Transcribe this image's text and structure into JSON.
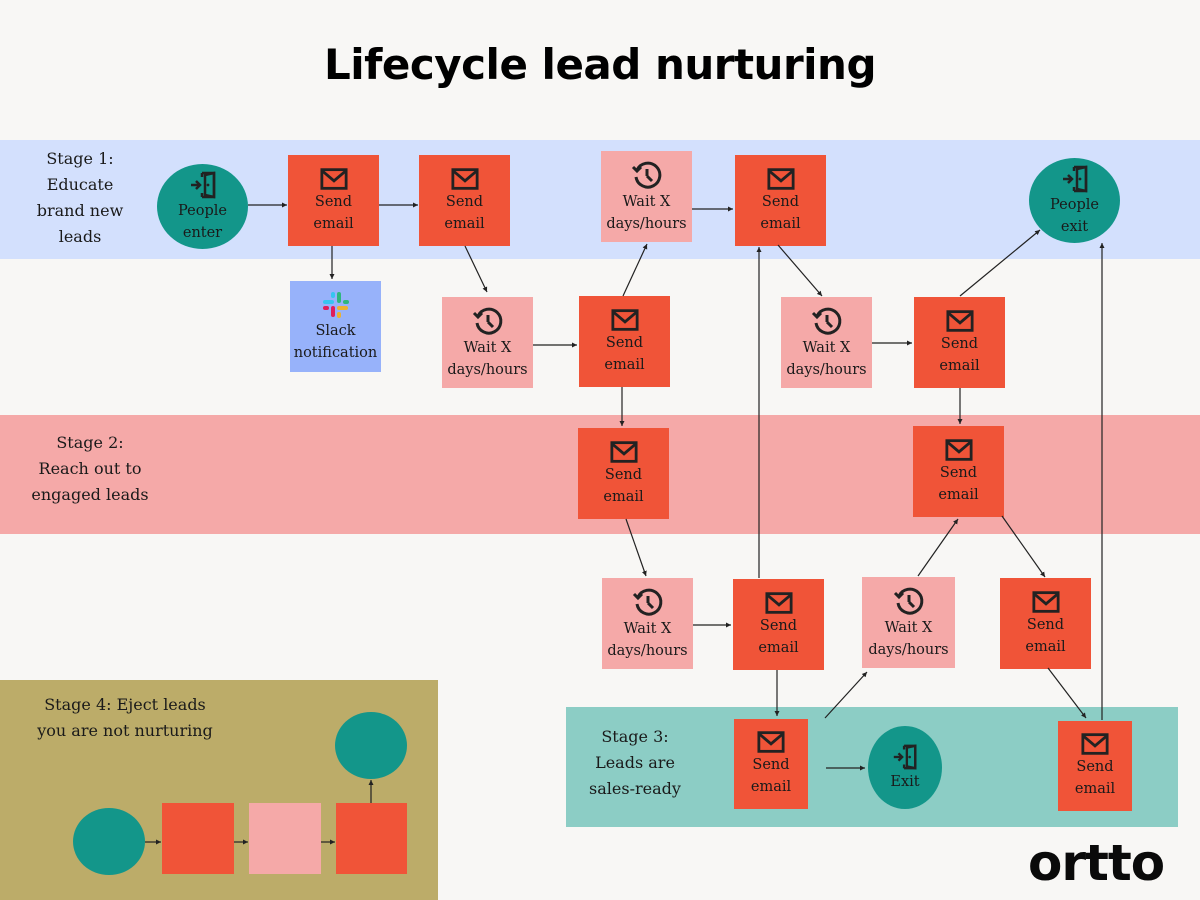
{
  "title": "Lifecycle lead nurturing",
  "colors": {
    "background": "#f8f7f5",
    "stage1_band": "#d3e0fd",
    "stage2_band": "#f5a9a8",
    "stage3_band": "#8ccdc5",
    "stage4_band": "#bcac69",
    "send_email": "#f05438",
    "wait": "#f5a9a8",
    "slack": "#97b2fa",
    "people_node": "#13968a"
  },
  "stages": {
    "stage1": {
      "line1": "Stage 1:",
      "line2": "Educate",
      "line3": "brand new",
      "line4": "leads"
    },
    "stage2": {
      "line1": "Stage 2:",
      "line2": "Reach out to",
      "line3": "engaged leads"
    },
    "stage3": {
      "line1": "Stage 3:",
      "line2": "Leads are",
      "line3": "sales-ready"
    },
    "stage4": {
      "line1": "Stage 4: Eject leads",
      "line2": "you are not nurturing"
    }
  },
  "nodes": {
    "people_enter": {
      "line1": "People",
      "line2": "enter",
      "icon": "door-enter-icon"
    },
    "people_exit": {
      "line1": "People",
      "line2": "exit",
      "icon": "door-enter-icon"
    },
    "exit": {
      "line1": "Exit",
      "icon": "door-enter-icon"
    },
    "send_email": {
      "line1": "Send",
      "line2": "email",
      "icon": "envelope-icon"
    },
    "wait": {
      "line1": "Wait X",
      "line2": "days/hours",
      "icon": "clock-history-icon"
    },
    "slack": {
      "line1": "Slack",
      "line2": "notification",
      "icon": "slack-icon"
    }
  },
  "logo": "ortto"
}
